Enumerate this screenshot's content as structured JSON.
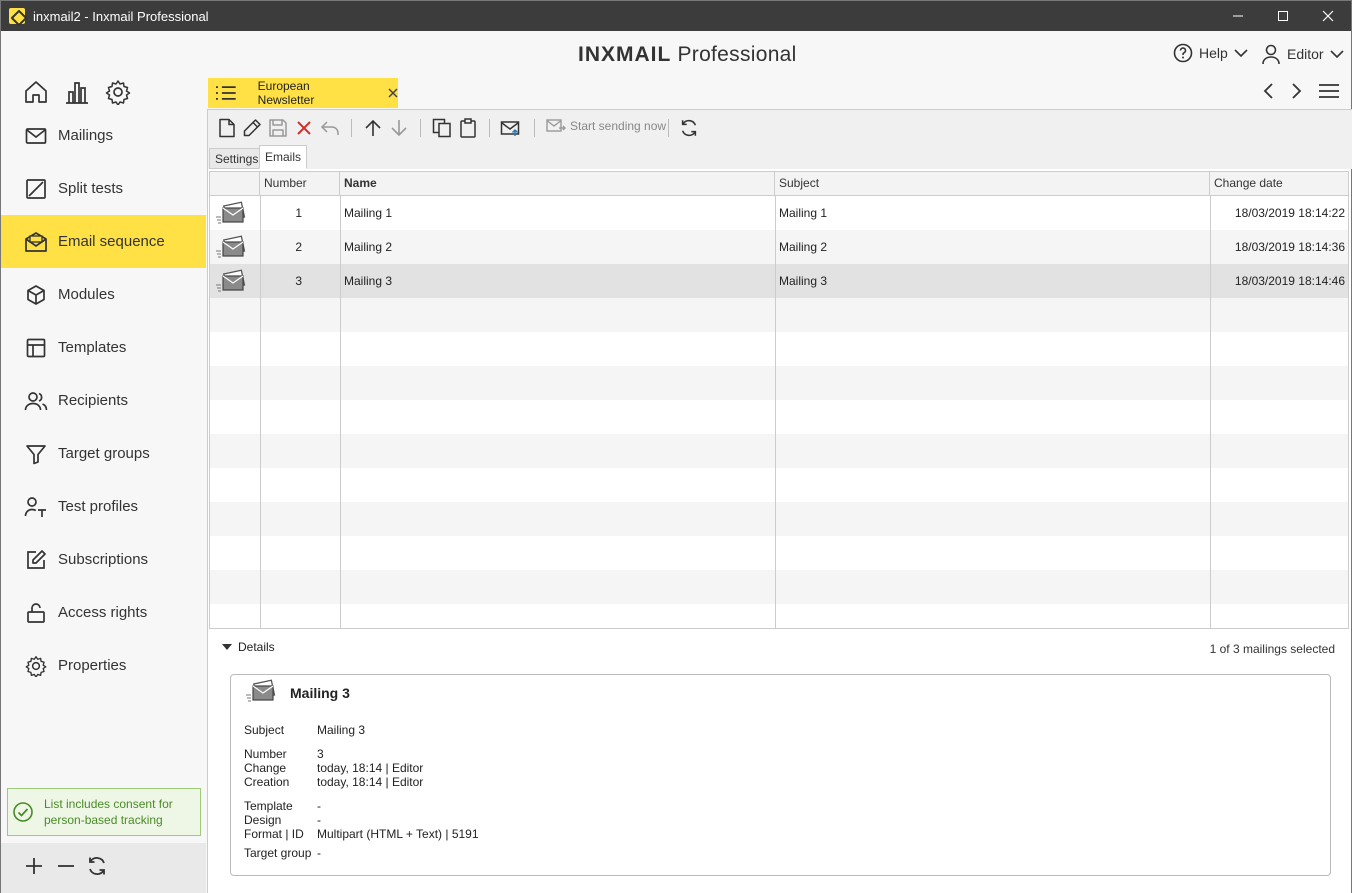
{
  "window": {
    "title": "inxmail2 - Inxmail Professional"
  },
  "header": {
    "brand_bold": "INXMAIL",
    "brand_light": "Professional",
    "help_label": "Help",
    "editor_label": "Editor"
  },
  "sidebar": {
    "items": [
      {
        "label": "Mailings",
        "icon": "envelope-icon"
      },
      {
        "label": "Split tests",
        "icon": "split-icon"
      },
      {
        "label": "Email sequence",
        "icon": "envelope-open-icon"
      },
      {
        "label": "Modules",
        "icon": "cube-icon"
      },
      {
        "label": "Templates",
        "icon": "template-icon"
      },
      {
        "label": "Recipients",
        "icon": "users-icon"
      },
      {
        "label": "Target groups",
        "icon": "filter-icon"
      },
      {
        "label": "Test profiles",
        "icon": "user-test-icon"
      },
      {
        "label": "Subscriptions",
        "icon": "edit-square-icon"
      },
      {
        "label": "Access rights",
        "icon": "unlock-icon"
      },
      {
        "label": "Properties",
        "icon": "gear-icon"
      }
    ],
    "active_index": 2,
    "consent_text": "List includes consent for person-based tracking"
  },
  "tab": {
    "label": "European Newsletter"
  },
  "toolbar": {
    "send_label": "Start sending now"
  },
  "subtabs": {
    "settings": "Settings",
    "emails": "Emails"
  },
  "table": {
    "columns": [
      "Number",
      "Name",
      "Subject",
      "Change date"
    ],
    "rows": [
      {
        "number": "1",
        "name": "Mailing 1",
        "subject": "Mailing 1",
        "change": "18/03/2019 18:14:22"
      },
      {
        "number": "2",
        "name": "Mailing 2",
        "subject": "Mailing 2",
        "change": "18/03/2019 18:14:36"
      },
      {
        "number": "3",
        "name": "Mailing 3",
        "subject": "Mailing 3",
        "change": "18/03/2019 18:14:46"
      }
    ],
    "selected_index": 2
  },
  "details": {
    "label": "Details",
    "selection_count": "1 of 3 mailings selected",
    "title": "Mailing 3",
    "subject_label": "Subject",
    "subject": "Mailing 3",
    "number_label": "Number",
    "number": "3",
    "change_label": "Change",
    "change": "today, 18:14 | Editor",
    "creation_label": "Creation",
    "creation": "today, 18:14 | Editor",
    "template_label": "Template",
    "template": "-",
    "design_label": "Design",
    "design": "-",
    "format_label": "Format | ID",
    "format": "Multipart (HTML + Text) | 5191",
    "target_label": "Target group",
    "target": "-"
  },
  "colors": {
    "accent": "#ffe146",
    "consent_green": "#4a8a28",
    "delete_red": "#d0302c"
  }
}
